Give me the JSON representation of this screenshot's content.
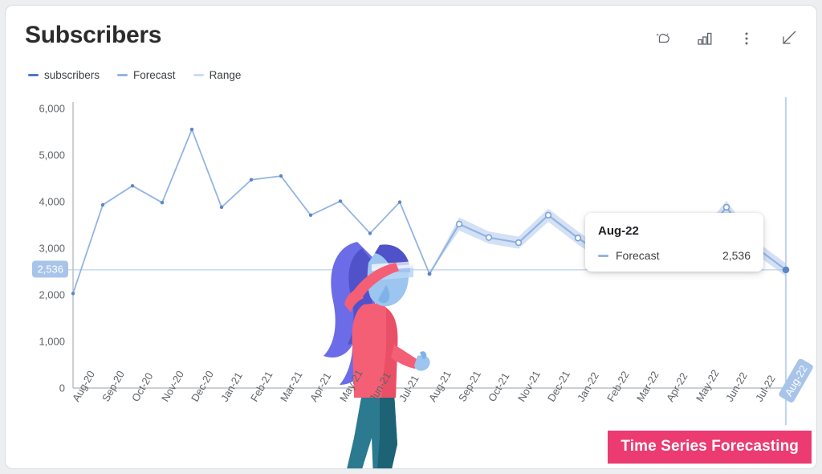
{
  "header": {
    "title": "Subscribers",
    "toolbar": [
      {
        "name": "ai-insights-icon",
        "label": "AI insights"
      },
      {
        "name": "bar-chart-icon",
        "label": "Chart type"
      },
      {
        "name": "more-vert-icon",
        "label": "More options"
      },
      {
        "name": "collapse-arrow-icon",
        "label": "Collapse"
      }
    ]
  },
  "legend": [
    {
      "label": "subscribers",
      "color": "#4e79c4"
    },
    {
      "label": "Forecast",
      "color": "#92b4e3"
    },
    {
      "label": "Range",
      "color": "#cddcf2"
    }
  ],
  "tooltip": {
    "title": "Aug-22",
    "series_swatch_color": "#92b4e3",
    "series_name": "Forecast",
    "value": "2,536"
  },
  "y_badge": {
    "value": "2,536",
    "background": "#a8c4e9",
    "text_color": "#ffffff"
  },
  "watermark": {
    "text": "Time Series Forecasting",
    "background": "#ec3b71"
  },
  "illustration": {
    "name": "woman-saluting-vr-illustration",
    "hair_color": "#6c6ce8",
    "hair_shadow": "#4f52c9",
    "shirt_color": "#f45f76",
    "pants_color": "#2b7a8f",
    "pants_shadow": "#1d6275",
    "skin_color": "#9cc5ef"
  },
  "chart_data": {
    "type": "line",
    "title": "Subscribers",
    "xlabel": "",
    "ylabel": "",
    "ylim": [
      0,
      6000
    ],
    "yticks": [
      0,
      1000,
      2000,
      3000,
      4000,
      5000,
      6000
    ],
    "ytick_labels": [
      "0",
      "1,000",
      "2,000",
      "3,000",
      "4,000",
      "5,000",
      "6,000"
    ],
    "grid": false,
    "legend_position": "top-left",
    "highlight_x": "Aug-22",
    "reference_line_y": 2536,
    "categories": [
      "Aug-20",
      "Sep-20",
      "Oct-20",
      "Nov-20",
      "Dec-20",
      "Jan-21",
      "Feb-21",
      "Mar-21",
      "Apr-21",
      "May-21",
      "Jun-21",
      "Jul-21",
      "Aug-21",
      "Sep-21",
      "Oct-21",
      "Nov-21",
      "Dec-21",
      "Jan-22",
      "Feb-22",
      "Mar-22",
      "Apr-22",
      "May-22",
      "Jun-22",
      "Jul-22",
      "Aug-22"
    ],
    "series": [
      {
        "name": "subscribers",
        "color": "#92b4e3",
        "values": [
          2030,
          3930,
          4340,
          3980,
          5550,
          3880,
          4470,
          4550,
          3710,
          4010,
          3320,
          3990,
          2450,
          null,
          null,
          null,
          null,
          null,
          null,
          null,
          null,
          null,
          null,
          null,
          null
        ]
      },
      {
        "name": "Forecast",
        "color": "#92b4e3",
        "values": [
          null,
          null,
          null,
          null,
          null,
          null,
          null,
          null,
          null,
          null,
          null,
          null,
          2450,
          3520,
          3230,
          3120,
          3710,
          3220,
          2790,
          2930,
          3400,
          3090,
          3880,
          3010,
          2536
        ]
      },
      {
        "name": "Range",
        "color": "#cddcf2",
        "upper": [
          null,
          null,
          null,
          null,
          null,
          null,
          null,
          null,
          null,
          null,
          null,
          null,
          2450,
          3660,
          3360,
          3250,
          3850,
          3360,
          2930,
          3070,
          3540,
          3230,
          4020,
          3150,
          2676
        ],
        "lower": [
          null,
          null,
          null,
          null,
          null,
          null,
          null,
          null,
          null,
          null,
          null,
          null,
          2450,
          3380,
          3100,
          2990,
          3570,
          3080,
          2650,
          2790,
          3260,
          2950,
          3740,
          2870,
          2396
        ]
      }
    ]
  }
}
